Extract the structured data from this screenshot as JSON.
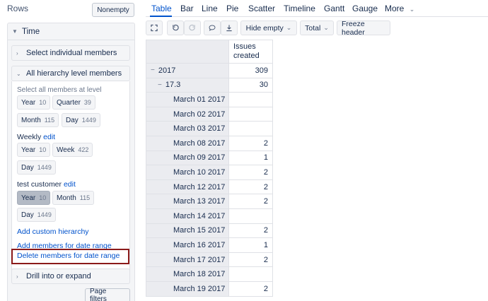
{
  "left": {
    "rows_title": "Rows",
    "nonempty": "Nonempty",
    "dimension": "Time",
    "select_individual": "Select individual members",
    "all_hierarchy": "All hierarchy level members",
    "select_all_at_level": "Select all members at level",
    "default_levels": [
      {
        "name": "Year",
        "count": "10"
      },
      {
        "name": "Quarter",
        "count": "39"
      },
      {
        "name": "Month",
        "count": "115"
      },
      {
        "name": "Day",
        "count": "1449"
      }
    ],
    "weekly": {
      "name": "Weekly",
      "edit": "edit",
      "levels": [
        {
          "name": "Year",
          "count": "10"
        },
        {
          "name": "Week",
          "count": "422"
        },
        {
          "name": "Day",
          "count": "1449"
        }
      ]
    },
    "custom": {
      "name": "test customer",
      "edit": "edit",
      "levels": [
        {
          "name": "Year",
          "count": "10"
        },
        {
          "name": "Month",
          "count": "115"
        },
        {
          "name": "Day",
          "count": "1449"
        }
      ]
    },
    "add_custom_hierarchy": "Add custom hierarchy",
    "add_members_date_range": "Add members for date range",
    "delete_members_date_range": "Delete members for date range",
    "drill": "Drill into or expand",
    "page_filters": "Page filters"
  },
  "tabs": [
    "Table",
    "Bar",
    "Line",
    "Pie",
    "Scatter",
    "Timeline",
    "Gantt",
    "Gauge",
    "More"
  ],
  "toolbar": {
    "icons": [
      "fullscreen-icon",
      "undo-icon",
      "redo-icon",
      "comment-icon",
      "download-icon"
    ],
    "hide_empty": "Hide empty",
    "total": "Total",
    "freeze_header": "Freeze header"
  },
  "table": {
    "column": "Issues created",
    "column_line1": "Issues",
    "column_line2": "created",
    "rows": [
      {
        "label": "2017",
        "value": "309",
        "level": 0,
        "expander": "−"
      },
      {
        "label": "17.3",
        "value": "30",
        "level": 1,
        "expander": "−"
      },
      {
        "label": "March 01 2017",
        "value": "",
        "level": 2
      },
      {
        "label": "March 02 2017",
        "value": "",
        "level": 2
      },
      {
        "label": "March 03 2017",
        "value": "",
        "level": 2
      },
      {
        "label": "March 08 2017",
        "value": "2",
        "level": 2
      },
      {
        "label": "March 09 2017",
        "value": "1",
        "level": 2
      },
      {
        "label": "March 10 2017",
        "value": "2",
        "level": 2
      },
      {
        "label": "March 12 2017",
        "value": "2",
        "level": 2
      },
      {
        "label": "March 13 2017",
        "value": "2",
        "level": 2
      },
      {
        "label": "March 14 2017",
        "value": "",
        "level": 2
      },
      {
        "label": "March 15 2017",
        "value": "2",
        "level": 2
      },
      {
        "label": "March 16 2017",
        "value": "1",
        "level": 2
      },
      {
        "label": "March 17 2017",
        "value": "2",
        "level": 2
      },
      {
        "label": "March 18 2017",
        "value": "",
        "level": 2
      },
      {
        "label": "March 19 2017",
        "value": "2",
        "level": 2
      }
    ]
  }
}
